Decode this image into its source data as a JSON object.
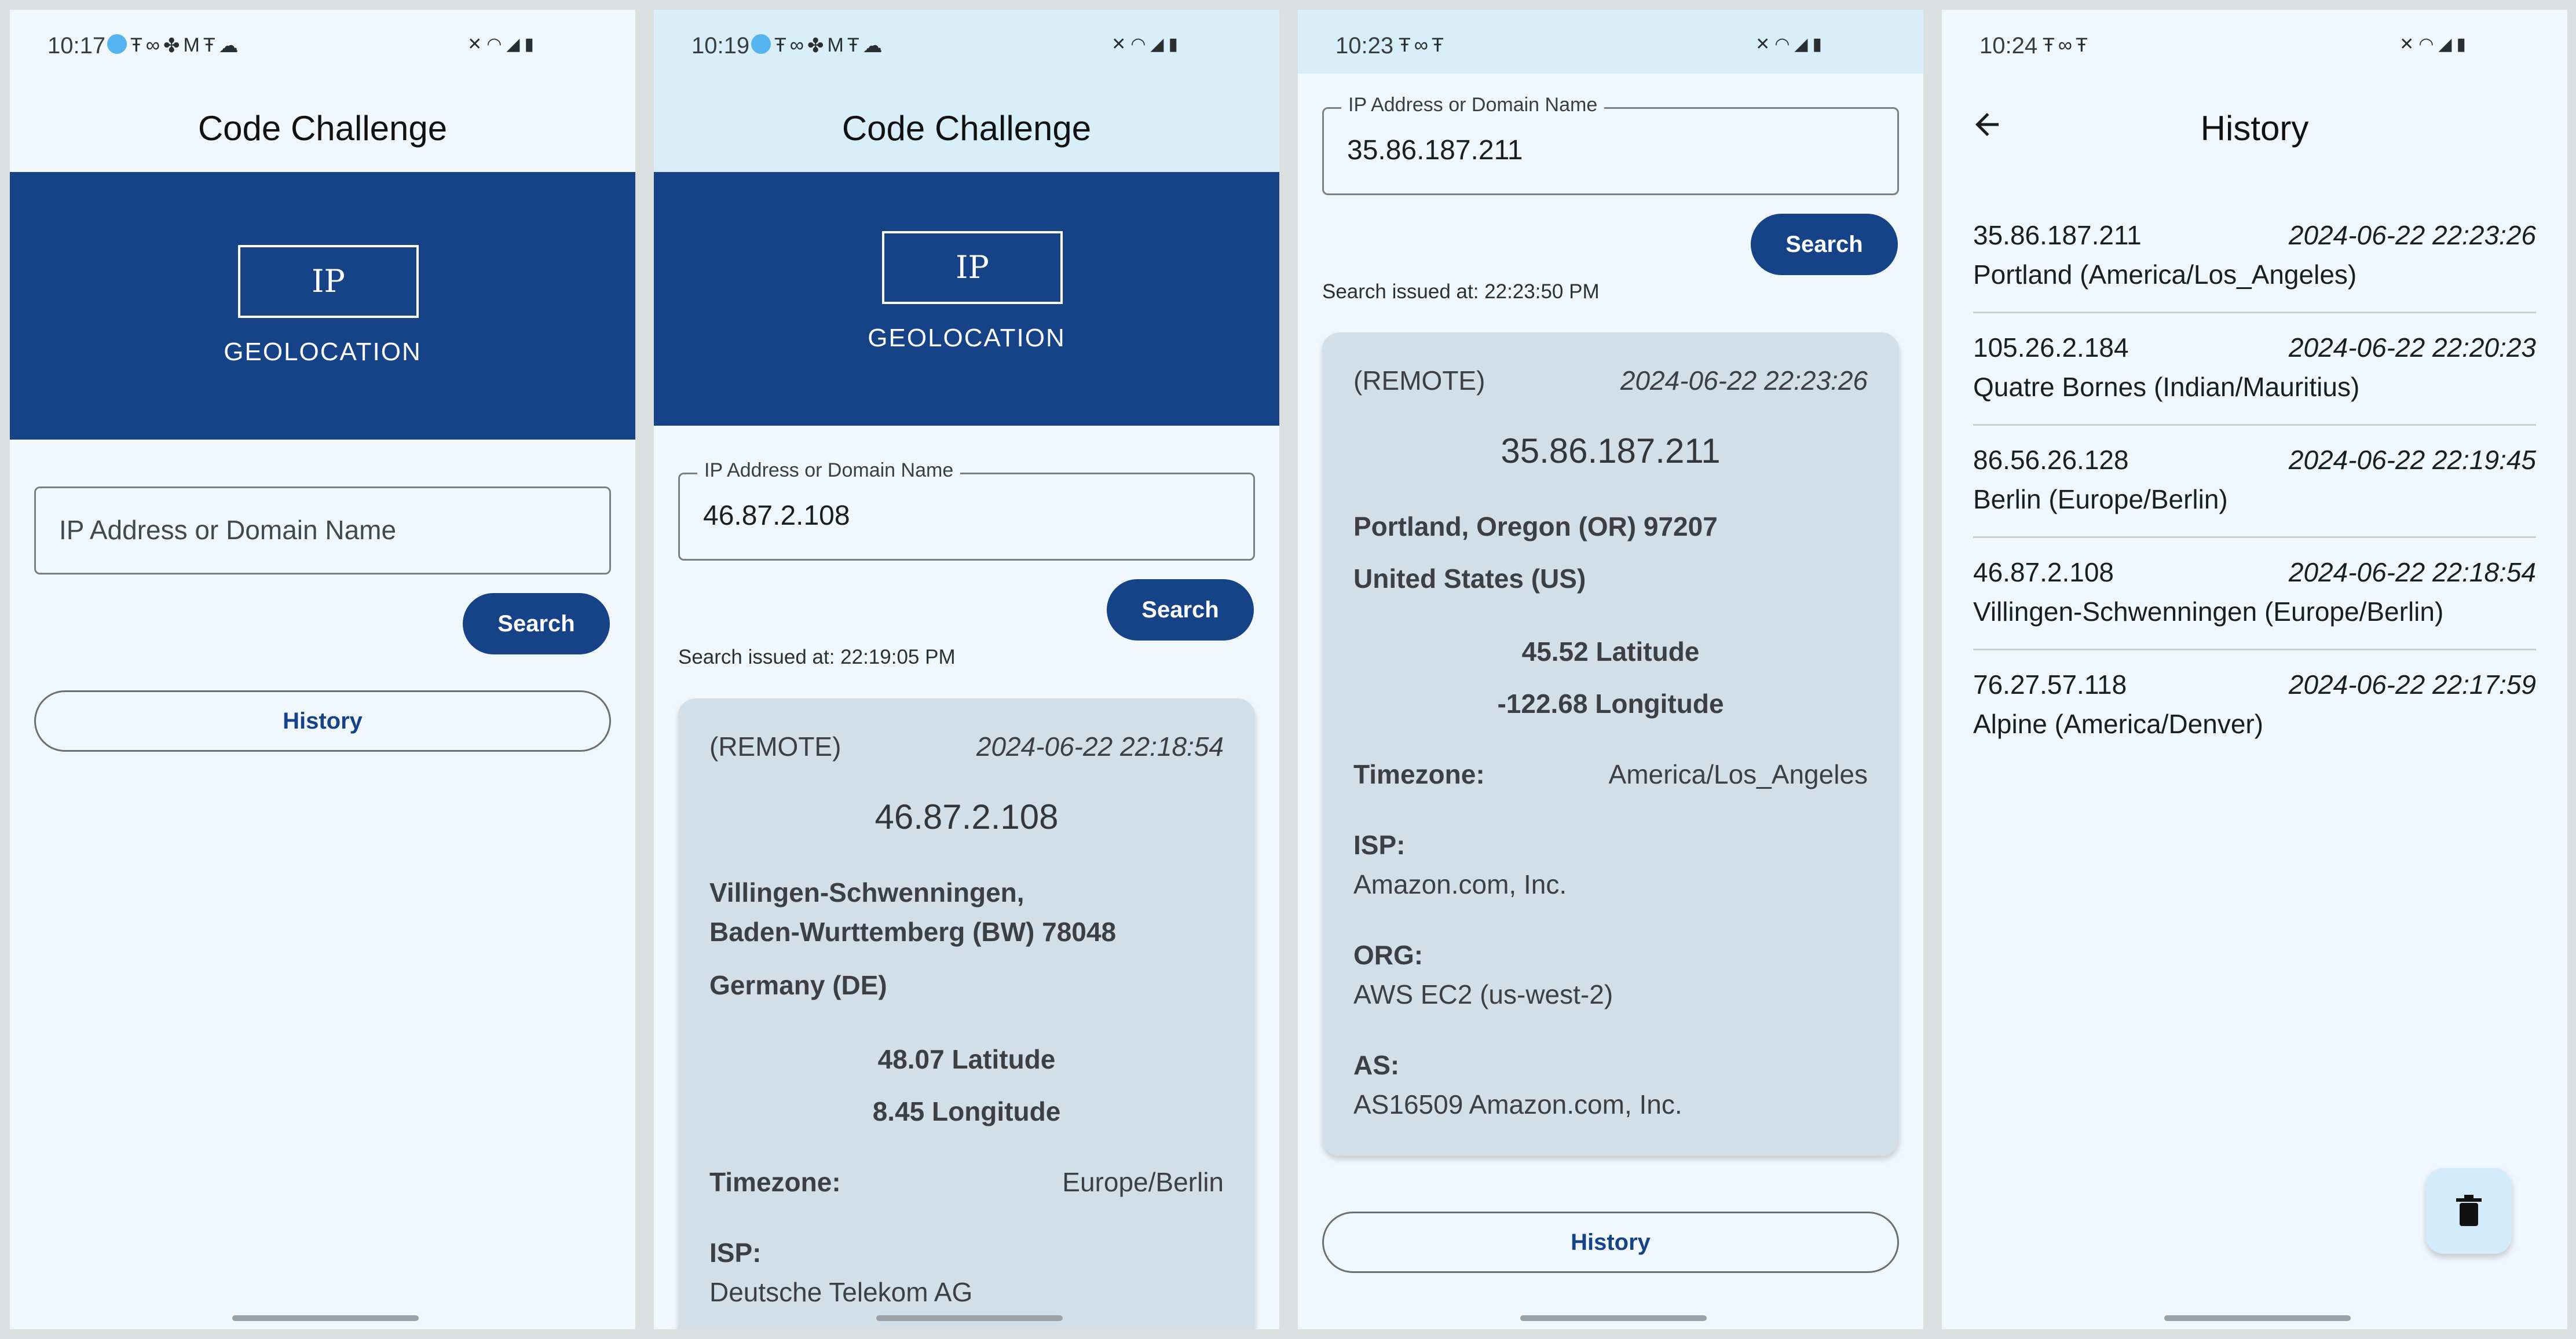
{
  "panels": [
    {
      "status_time": "10:17",
      "title": "Code Challenge",
      "logo_text": "IP",
      "logo_sub": "GEOLOCATION",
      "input_placeholder": "IP Address or Domain Name",
      "search_label": "Search",
      "history_label": "History"
    },
    {
      "status_time": "10:19",
      "title": "Code Challenge",
      "logo_text": "IP",
      "logo_sub": "GEOLOCATION",
      "input_label": "IP Address or Domain Name",
      "input_value": "46.87.2.108",
      "search_label": "Search",
      "issued": "Search issued at: 22:19:05 PM",
      "result": {
        "source": "(REMOTE)",
        "timestamp": "2024-06-22 22:18:54",
        "ip": "46.87.2.108",
        "city_line1": "Villingen-Schwenningen,",
        "city_line2": "Baden-Wurttemberg (BW) 78048",
        "country": "Germany (DE)",
        "latitude": "48.07 Latitude",
        "longitude": "8.45 Longitude",
        "timezone_label": "Timezone:",
        "timezone": "Europe/Berlin",
        "isp_label": "ISP:",
        "isp": "Deutsche Telekom AG"
      }
    },
    {
      "status_time": "10:23",
      "input_label": "IP Address or Domain Name",
      "input_value": "35.86.187.211",
      "search_label": "Search",
      "issued": "Search issued at: 22:23:50 PM",
      "result": {
        "source": "(REMOTE)",
        "timestamp": "2024-06-22 22:23:26",
        "ip": "35.86.187.211",
        "city_line1": "Portland, Oregon (OR) 97207",
        "country": "United States (US)",
        "latitude": "45.52 Latitude",
        "longitude": "-122.68 Longitude",
        "timezone_label": "Timezone:",
        "timezone": "America/Los_Angeles",
        "isp_label": "ISP:",
        "isp": "Amazon.com, Inc.",
        "org_label": "ORG:",
        "org": "AWS EC2 (us-west-2)",
        "as_label": "AS:",
        "as": "AS16509 Amazon.com, Inc."
      },
      "history_label": "History"
    },
    {
      "status_time": "10:24",
      "title": "History",
      "items": [
        {
          "ip": "35.86.187.211",
          "timestamp": "2024-06-22 22:23:26",
          "location": "Portland (America/Los_Angeles)"
        },
        {
          "ip": "105.26.2.184",
          "timestamp": "2024-06-22 22:20:23",
          "location": "Quatre Bornes (Indian/Mauritius)"
        },
        {
          "ip": "86.56.26.128",
          "timestamp": "2024-06-22 22:19:45",
          "location": "Berlin (Europe/Berlin)"
        },
        {
          "ip": "46.87.2.108",
          "timestamp": "2024-06-22 22:18:54",
          "location": "Villingen-Schwenningen (Europe/Berlin)"
        },
        {
          "ip": "76.27.57.118",
          "timestamp": "2024-06-22 22:17:59",
          "location": "Alpine (America/Denver)"
        }
      ]
    }
  ],
  "colors": {
    "brand": "#164288",
    "background": "#f1f8fd",
    "card": "#d3dfe8",
    "fab": "#d4ebfb"
  },
  "icons": [
    "mute-icon",
    "wifi-icon",
    "signal-icon",
    "battery-icon",
    "back-arrow-icon",
    "trash-icon"
  ]
}
